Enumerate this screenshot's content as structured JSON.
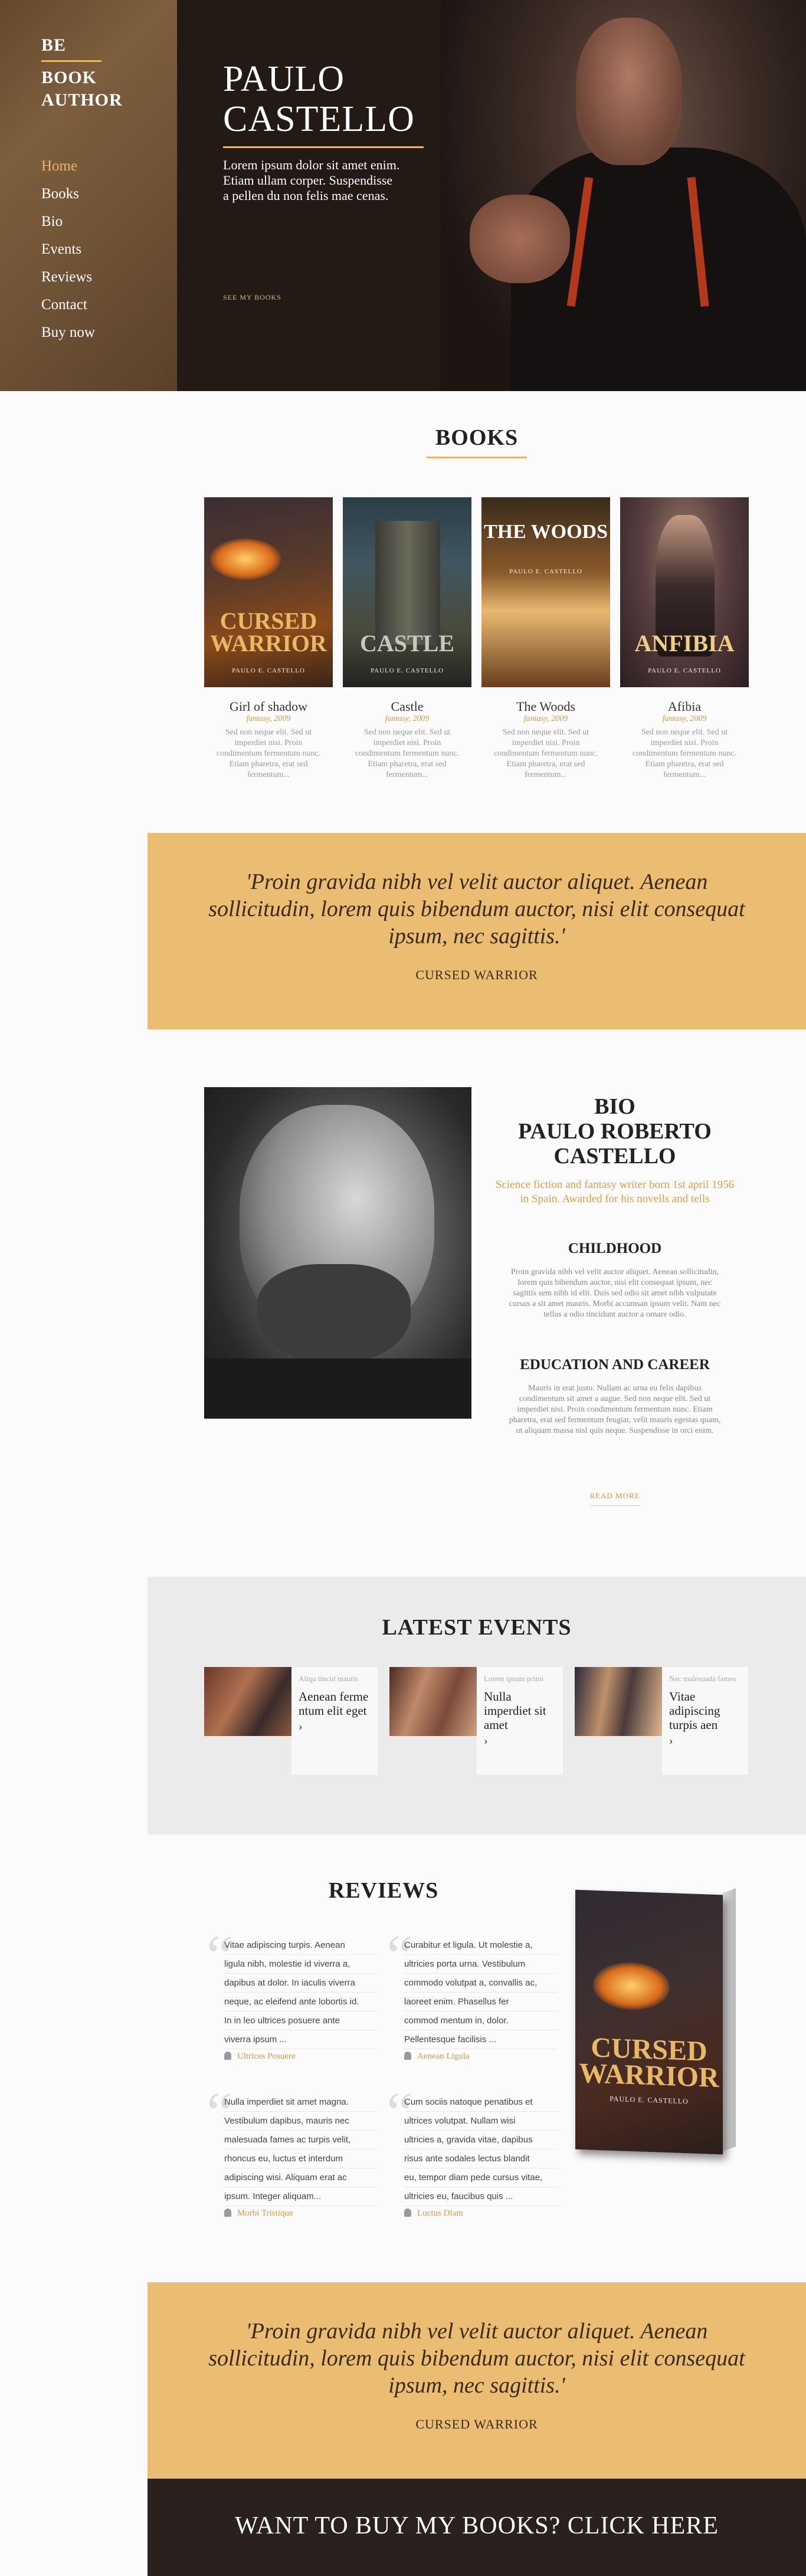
{
  "sidebar": {
    "logo_line1": "BE",
    "logo_line2": "BOOK",
    "logo_line3": "AUTHOR",
    "nav": [
      "Home",
      "Books",
      "Bio",
      "Events",
      "Reviews",
      "Contact",
      "Buy now"
    ]
  },
  "hero": {
    "name_line1": "PAULO",
    "name_line2": "CASTELLO",
    "text": "Lorem ipsum dolor sit amet enim. Etiam ullam corper. Suspendisse a pellen du non felis mae cenas.",
    "cta": "SEE MY BOOKS"
  },
  "books": {
    "title": "BOOKS",
    "items": [
      {
        "title": "Girl of shadow",
        "genre": "fantasy, 2009",
        "desc": "Sed non neque elit. Sed ut imperdiet nisi. Proin condimentum fermentum nunc. Etiam pharetra, erat sed fermentum...",
        "cover_title": "CURSED WARRIOR",
        "cover_author": "PAULO E. CASTELLO"
      },
      {
        "title": "Castle",
        "genre": "fantasy, 2009",
        "desc": "Sed non neque elit. Sed ut imperdiet nisi. Proin condimentum fermentum nunc. Etiam pharetra, erat sed fermentum...",
        "cover_title": "CASTLE",
        "cover_author": "PAULO E. CASTELLO"
      },
      {
        "title": "The Woods",
        "genre": "fantasy, 2009",
        "desc": "Sed non neque elit. Sed ut imperdiet nisi. Proin condimentum fermentum nunc. Etiam pharetra, erat sed fermentum...",
        "cover_title": "THE WOODS",
        "cover_author": "PAULO E. CASTELLO"
      },
      {
        "title": "Afibia",
        "genre": "fantasy, 2009",
        "desc": "Sed non neque elit. Sed ut imperdiet nisi. Proin condimentum fermentum nunc. Etiam pharetra, erat sed fermentum...",
        "cover_title": "ANFIBIA",
        "cover_author": "PAULO E. CASTELLO"
      }
    ]
  },
  "quote": {
    "text": "'Proin gravida nibh vel velit auctor aliquet. Aenean sollicitudin, lorem quis bibendum auctor, nisi elit consequat ipsum, nec sagittis.'",
    "author": "CURSED WARRIOR"
  },
  "bio": {
    "title_line1": "BIO",
    "title_line2": "PAULO ROBERTO",
    "title_line3": "CASTELLO",
    "subtitle": "Science fiction and fantasy writer born 1st april 1956 in Spain. Awarded for his novells and tells",
    "childhood_heading": "CHILDHOOD",
    "childhood_text": "Proin gravida nibh vel velit auctor aliquet. Aenean sollicitudin, lorem quis bibendum auctor, nisi elit consequat ipsum, nec sagittis sem nibh id elit. Duis sed odio sit amet nibh vulputate cursus a sit amet mauris. Morbi accumsan ipsum velit. Nam nec tellus a odio tincidunt auctor a ornare odio.",
    "career_heading": "EDUCATION AND CAREER",
    "career_text": "Mauris in erat justo. Nullam ac urna eu felis dapibus condimentum sit amet a augue. Sed non neque elit. Sed ut imperdiet nisi. Proin condimentum fermentum nunc. Etiam pharetra, erat sed fermentum feugiat, velit mauris egestas quam, ut aliquam massa nisl quis neque. Suspendisse in orci enim.",
    "read_more": "READ MORE"
  },
  "events": {
    "title": "LATEST EVENTS",
    "items": [
      {
        "category": "Aliqu tincid mauris",
        "title": "Aenean ferme ntum elit eget",
        "arrow": "›"
      },
      {
        "category": "Lorem ipsum primi",
        "title": "Nulla imperdiet sit amet",
        "arrow": "›"
      },
      {
        "category": "Nec malesuada fames",
        "title": "Vitae adipiscing turpis aen",
        "arrow": "›"
      }
    ]
  },
  "reviews": {
    "title": "REVIEWS",
    "items": [
      {
        "lines": [
          "Vitae adipiscing turpis. Aenean",
          "ligula nibh, molestie id viverra a,",
          "dapibus at dolor. In iaculis viverra",
          "neque, ac eleifend ante lobortis id.",
          "In in leo ultrices posuere ante",
          "viverra ipsum ..."
        ],
        "author": "Ultrices Posuere"
      },
      {
        "lines": [
          "Curabitur et ligula. Ut molestie a,",
          "ultricies porta urna. Vestibulum",
          "commodo volutpat a, convallis ac,",
          "laoreet enim. Phasellus fer",
          "commod mentum in, dolor.",
          "Pellentesque facilisis ..."
        ],
        "author": "Aenean Ligula"
      },
      {
        "lines": [
          "Nulla imperdiet sit amet magna.",
          "Vestibulum dapibus, mauris nec",
          "malesuada fames ac turpis velit,",
          "rhoncus eu, luctus et interdum",
          "adipiscing wisi. Aliquam erat ac",
          "ipsum. Integer aliquam..."
        ],
        "author": "Morbi Tristique"
      },
      {
        "lines": [
          "Cum sociis natoque penatibus et",
          "ultrices volutpat. Nullam wisi",
          "ultricies a, gravida vitae, dapibus",
          "risus ante sodales lectus blandit",
          "eu, tempor diam pede cursus vitae,",
          "ultricies eu, faucibus quis ..."
        ],
        "author": "Luctus Diam"
      }
    ],
    "book_title": "CURSED WARRIOR",
    "book_author": "PAULO E. CASTELLO"
  },
  "buy": {
    "text": "WANT TO BUY MY BOOKS? CLICK HERE"
  },
  "colors": {
    "accent": "#e8b864",
    "quote_bg": "#ebbd72",
    "dark": "#2a201d"
  }
}
